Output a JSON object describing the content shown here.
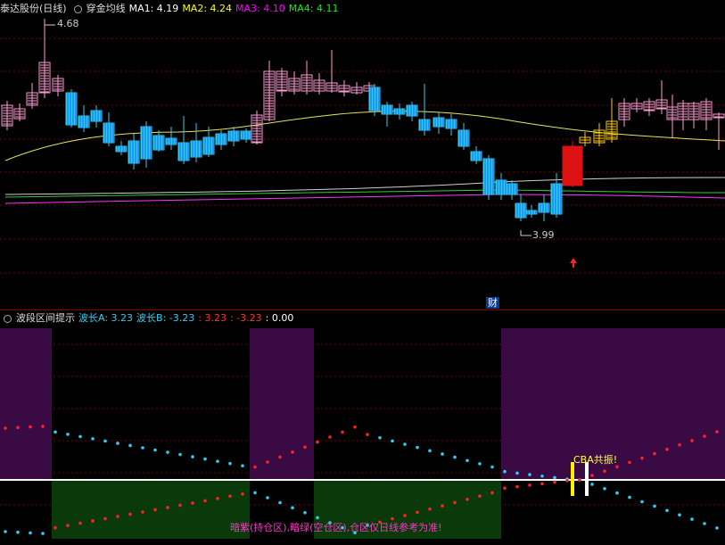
{
  "top_header": {
    "stock_label": "泰达股份(日线)",
    "indicator_name": "穿金均线",
    "ma": [
      {
        "label": "MA1: 4.19",
        "color": "#ffffff"
      },
      {
        "label": "MA2: 4.24",
        "color": "#ffff00"
      },
      {
        "label": "MA3: 4.10",
        "color": "#ff00ff"
      },
      {
        "label": "MA4: 4.11",
        "color": "#00ff00"
      }
    ]
  },
  "price_pane": {
    "high_label": "4.68",
    "low_label": "3.99",
    "cai_badge": "财",
    "colors": {
      "up": "#ff9ad5",
      "down": "#33ccee",
      "bigred": "#dd1111",
      "gold": "#ffcc00",
      "ma_white": "#cfcfcf",
      "ma_yellow": "#e6e65a",
      "ma_magenta": "#ff33ff",
      "ma_green": "#33cc33"
    }
  },
  "bottom_header": {
    "indicator_name": "波段区间提示",
    "items": [
      {
        "label": "波长A: 3.23",
        "color": "#33ccee"
      },
      {
        "label": "波长B: -3.23",
        "color": "#33ccee"
      },
      {
        "label": ": 3.23",
        "color": "#ff3333"
      },
      {
        "label": ": -3.23",
        "color": "#ff3333"
      },
      {
        "label": ": 0.00",
        "color": "#ffffff"
      }
    ]
  },
  "band_pane": {
    "note": "暗紫(持仓区),暗绿(空仓区),仓区仅日线参考为准!",
    "cba_label": "CBA共振!",
    "colors": {
      "purple": "#3a0a44",
      "green": "#0a3a0a",
      "zero": "#ffffff",
      "dot_red": "#ff2222",
      "dot_cyan": "#33ccee"
    }
  }
}
